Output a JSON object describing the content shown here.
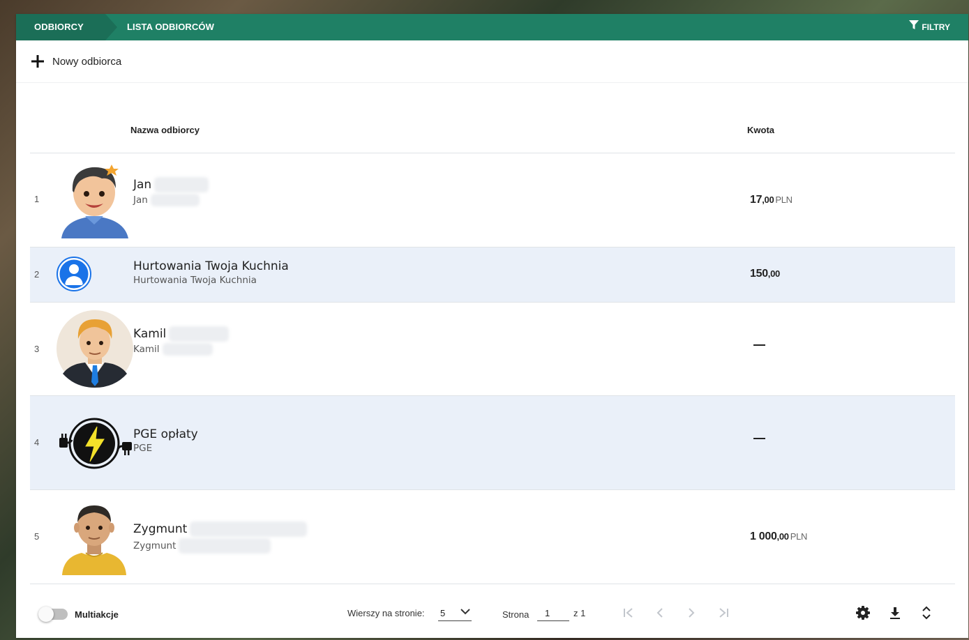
{
  "topbar": {
    "breadcrumb_root": "ODBIORCY",
    "breadcrumb_current": "LISTA ODBIORCÓW",
    "filter_label": "FILTRY"
  },
  "toolbar": {
    "new_label": "Nowy odbiorca"
  },
  "table": {
    "columns": {
      "name": "Nazwa odbiorcy",
      "amount": "Kwota"
    },
    "rows": [
      {
        "index": "1",
        "name": "Jan",
        "sub": "Jan",
        "amount_int": "17",
        "amount_dec": ",00",
        "currency": "PLN",
        "avatar": "cartoon-man-avatar"
      },
      {
        "index": "2",
        "name": "Hurtowania Twoja Kuchnia",
        "sub": "Hurtowania Twoja Kuchnia",
        "amount_int": "150",
        "amount_dec": ",00",
        "currency": "",
        "avatar": "default-user-icon"
      },
      {
        "index": "3",
        "name": "Kamil",
        "sub": "Kamil",
        "amount_int": "",
        "amount_dec": "",
        "currency": "",
        "avatar": "businessman-avatar"
      },
      {
        "index": "4",
        "name": "PGE opłaty",
        "sub": "PGE",
        "amount_int": "",
        "amount_dec": "",
        "currency": "",
        "avatar": "electricity-bolt-icon"
      },
      {
        "index": "5",
        "name": "Zygmunt",
        "sub": "Zygmunt",
        "amount_int": "1 000",
        "amount_dec": ",00",
        "currency": "PLN",
        "avatar": "man-yellow-shirt-avatar"
      }
    ]
  },
  "footer": {
    "multi_label": "Multiakcje",
    "rows_per_page_label": "Wierszy na stronie:",
    "rows_per_page_value": "5",
    "page_label": "Strona",
    "page_value": "1",
    "of_label": "z 1"
  },
  "colors": {
    "header_bg": "#1f8065",
    "row_alt_bg": "#eaf0f9"
  }
}
